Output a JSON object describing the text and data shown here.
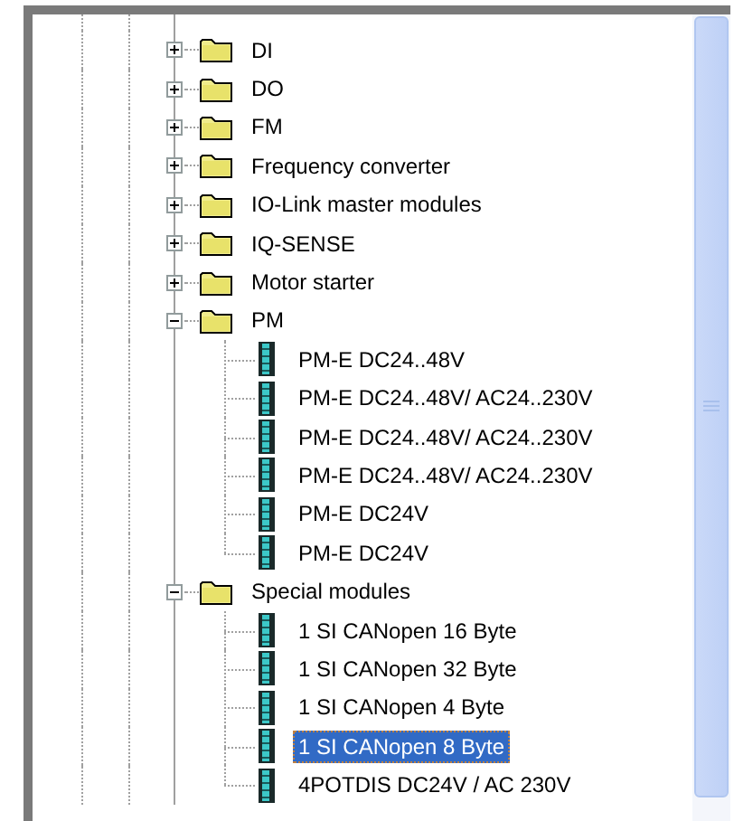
{
  "tree": {
    "items": [
      {
        "label": "DI",
        "expanded": false
      },
      {
        "label": "DO",
        "expanded": false
      },
      {
        "label": "FM",
        "expanded": false
      },
      {
        "label": "Frequency converter",
        "expanded": false
      },
      {
        "label": "IO-Link master modules",
        "expanded": false
      },
      {
        "label": "IQ-SENSE",
        "expanded": false
      },
      {
        "label": "Motor starter",
        "expanded": false
      },
      {
        "label": "PM",
        "expanded": true,
        "children": [
          {
            "label": "PM-E DC24..48V",
            "selected": false
          },
          {
            "label": "PM-E DC24..48V/ AC24..230V",
            "selected": false
          },
          {
            "label": "PM-E DC24..48V/ AC24..230V",
            "selected": false
          },
          {
            "label": "PM-E DC24..48V/ AC24..230V",
            "selected": false
          },
          {
            "label": "PM-E DC24V",
            "selected": false
          },
          {
            "label": "PM-E DC24V",
            "selected": false
          }
        ]
      },
      {
        "label": "Special modules",
        "expanded": true,
        "children": [
          {
            "label": "1 SI CANopen 16 Byte",
            "selected": false
          },
          {
            "label": "1 SI CANopen 32 Byte",
            "selected": false
          },
          {
            "label": "1 SI CANopen 4 Byte",
            "selected": false
          },
          {
            "label": "1 SI CANopen 8 Byte",
            "selected": true
          },
          {
            "label": "4POTDIS DC24V / AC 230V",
            "selected": false
          }
        ]
      }
    ]
  }
}
